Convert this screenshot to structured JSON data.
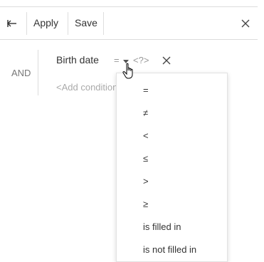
{
  "toolbar": {
    "back_icon": "back-arrow-icon",
    "apply_label": "Apply",
    "save_label": "Save",
    "close_icon": "close-icon"
  },
  "filter": {
    "group_operator": "AND",
    "condition": {
      "field": "Birth date",
      "operator": "=",
      "value_placeholder": "<?>"
    },
    "add_condition_label": "<Add condition>"
  },
  "operator_menu": {
    "options": [
      "=",
      "≠",
      "<",
      "≤",
      ">",
      "≥",
      "is filled in",
      "is not filled in"
    ]
  },
  "colors": {
    "border": "#dcdcdc",
    "text": "#333333",
    "muted": "#999999"
  }
}
